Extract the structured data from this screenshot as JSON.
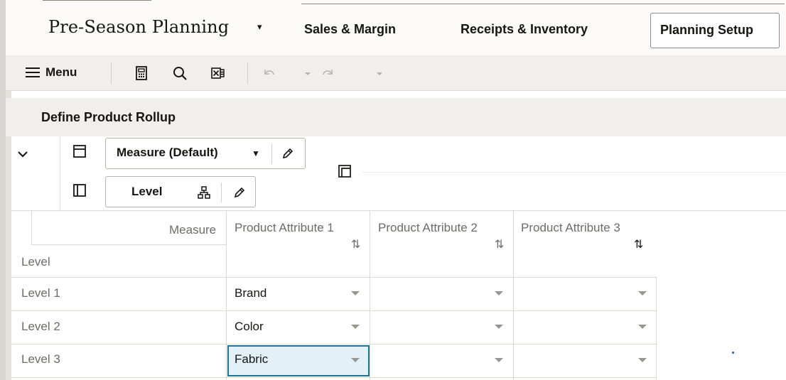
{
  "app": {
    "title": "Pre-Season Planning",
    "caret": "▾"
  },
  "nav": {
    "tabs": [
      {
        "label": "Sales & Margin"
      },
      {
        "label": "Receipts & Inventory"
      },
      {
        "label": "Planning Setup",
        "active": true
      }
    ]
  },
  "toolbar": {
    "menu_label": "Menu",
    "icons": [
      "calculator-icon",
      "search-icon",
      "export-excel-icon",
      "undo-icon",
      "undo-dropdown-icon",
      "redo-icon",
      "redo-dropdown-icon"
    ]
  },
  "panel": {
    "title": "Define Product Rollup",
    "row_pivot": {
      "label": "Measure (Default)"
    },
    "col_pivot": {
      "label": "Level"
    }
  },
  "grid": {
    "corner_top": "Measure",
    "corner_bottom": "Level",
    "columns": [
      "Product Attribute 1",
      "Product Attribute 2",
      "Product Attribute 3"
    ],
    "sort_glyph": "⇅",
    "rows": [
      {
        "label": "Level 1",
        "values": [
          "Brand",
          "",
          ""
        ]
      },
      {
        "label": "Level 2",
        "values": [
          "Color",
          "",
          ""
        ]
      },
      {
        "label": "Level 3",
        "values": [
          "Fabric",
          "",
          ""
        ]
      }
    ],
    "selected": {
      "row": 2,
      "col": 0
    }
  },
  "colors": {
    "accent": "#1e7693",
    "selected_bg": "#e1f1f7",
    "header_bg": "#f1efed"
  }
}
